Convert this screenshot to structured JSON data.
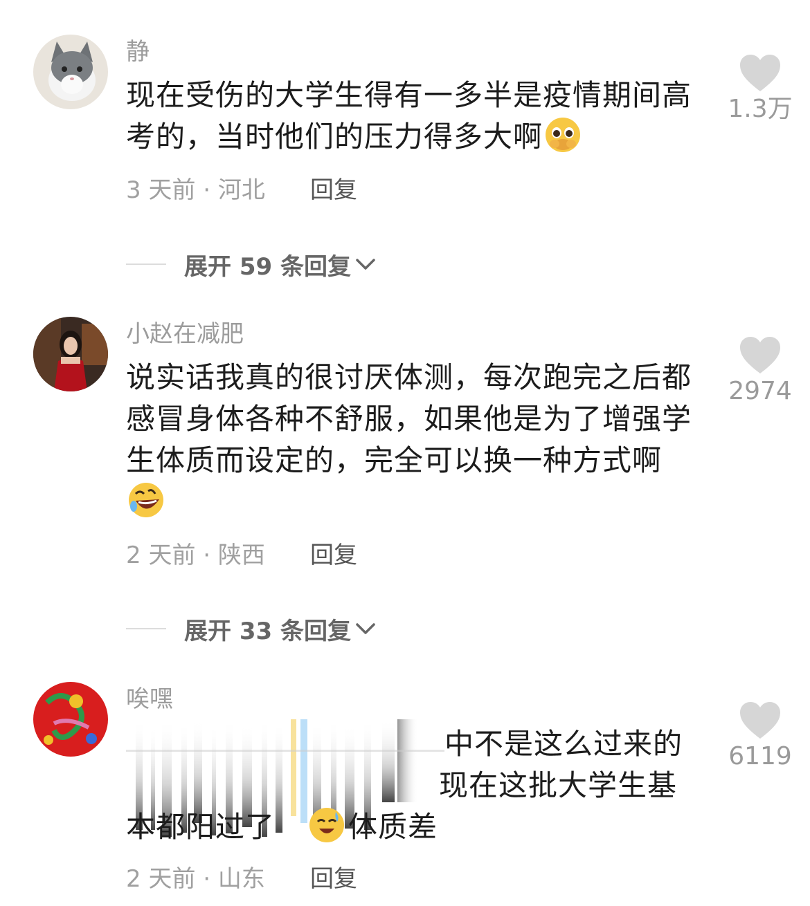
{
  "comments": [
    {
      "username": "静",
      "text": "现在受伤的大学生得有一多半是疫情期间高考的，当时他们的压力得多大啊",
      "emoji": "pleading-face-emoji",
      "time_location": "3 天前 · 河北",
      "reply_label": "回复",
      "likes": "1.3万",
      "expand_label": "展开 59 条回复"
    },
    {
      "username": "小赵在减肥",
      "text": "说实话我真的很讨厌体测，每次跑完之后都感冒身体各种不舒服，如果他是为了增强学生体质而设定的，完全可以换一种方式啊",
      "emoji": "rolling-laughing-emoji",
      "time_location": "2 天前 · 陕西",
      "reply_label": "回复",
      "likes": "2974",
      "expand_label": "展开 33 条回复"
    },
    {
      "username": "唉嘿",
      "text_line1": "中不是这么过来的",
      "text_line2": "现在这批大学生基",
      "text_line3_a": "本都阳过了",
      "text_line3_b": "体质差",
      "emoji": "sweat-smile-emoji",
      "time_location": "2 天前 · 山东",
      "reply_label": "回复",
      "likes": "6119"
    }
  ],
  "colors": {
    "like_heart": "#d6d6d6",
    "username": "#9c9c9c",
    "text": "#1c1c1c"
  }
}
